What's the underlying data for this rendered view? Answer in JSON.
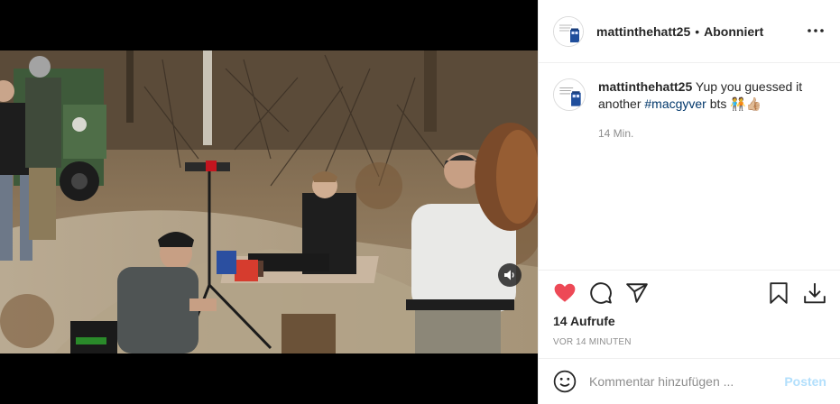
{
  "post": {
    "username": "mattinthehatt25",
    "follow_label": "Abonniert",
    "separator": "•",
    "caption_user": "mattinthehatt25",
    "caption_text_before": "Yup you guessed it another ",
    "caption_hashtag": "#macgyver",
    "caption_text_after": " bts ",
    "caption_emoji": "🧑‍🤝‍🧑👍🏼",
    "caption_time": "14 Min.",
    "views": "14 Aufrufe",
    "posted_ago": "VOR 14 MINUTEN"
  },
  "comment_box": {
    "placeholder": "Kommentar hinzufügen ...",
    "post_label": "Posten"
  },
  "icons": {
    "like": "heart-icon",
    "comment": "comment-icon",
    "share": "paper-plane-icon",
    "save": "bookmark-icon",
    "download": "download-icon",
    "more": "more-dots-icon",
    "mute": "speaker-icon",
    "emoji": "smiley-icon"
  },
  "colors": {
    "like": "#ed4956",
    "hashtag": "#00376b",
    "post_button_disabled": "#b2dffc",
    "secondary_text": "#8e8e8e"
  }
}
